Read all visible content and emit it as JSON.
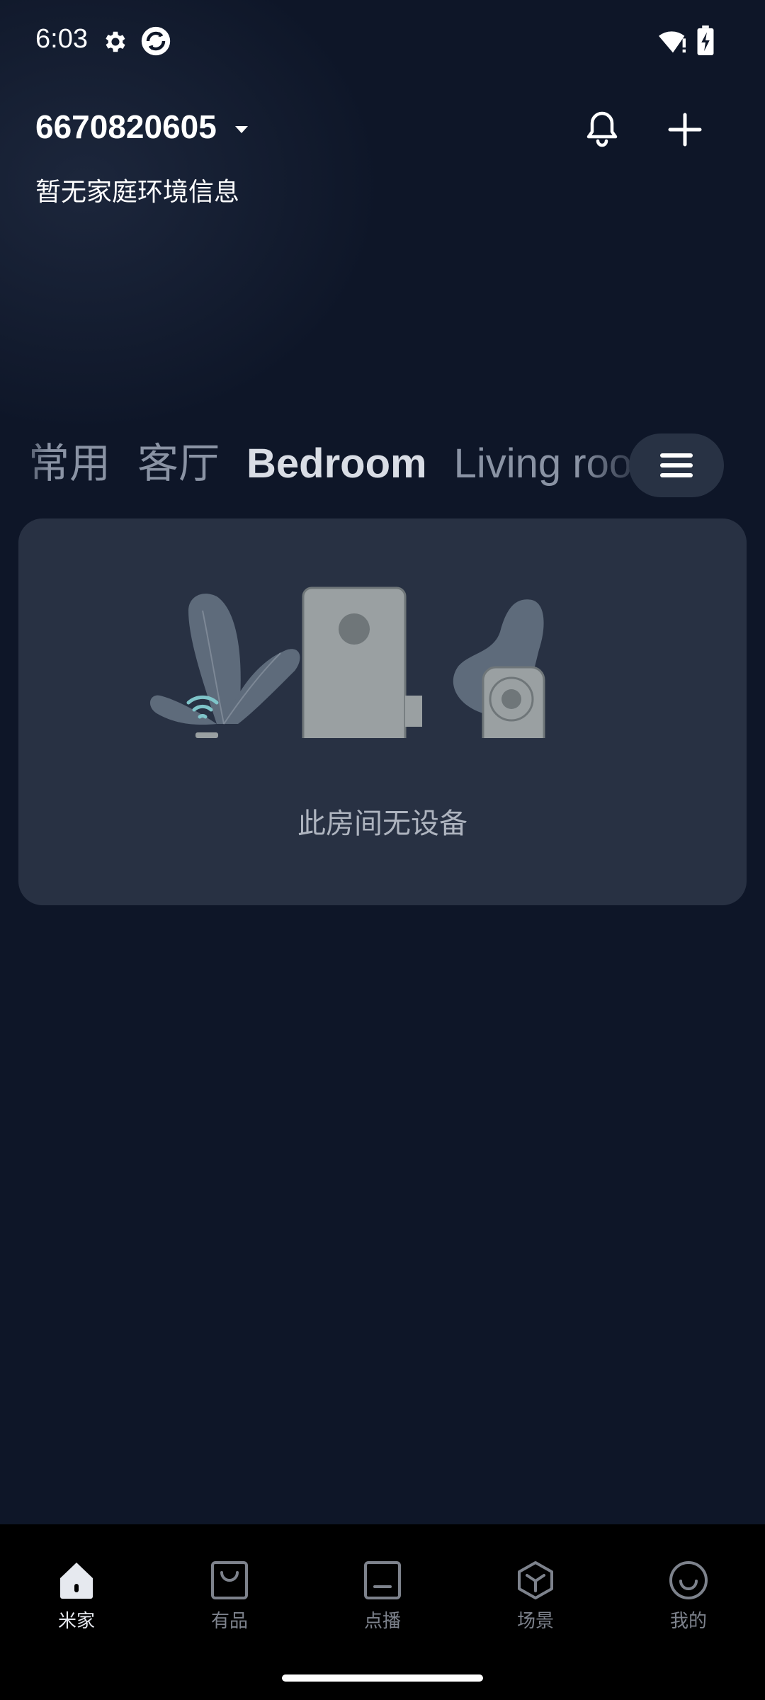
{
  "status_bar": {
    "time": "6:03",
    "icons": [
      "gear-icon",
      "app-sync-icon",
      "wifi-alert-icon",
      "battery-charging-icon"
    ]
  },
  "header": {
    "home_name": "6670820605",
    "env_info": "暂无家庭环境信息",
    "icons": [
      "caret-down-icon",
      "bell-icon",
      "plus-icon"
    ]
  },
  "rooms": {
    "tabs": [
      {
        "label": "常用"
      },
      {
        "label": "客厅"
      },
      {
        "label": "Bedroom",
        "active": true
      },
      {
        "label": "Living room"
      }
    ],
    "menu_icon": "menu-icon"
  },
  "room_card": {
    "empty_message": "此房间无设备"
  },
  "bottom_nav": {
    "items": [
      {
        "label": "米家",
        "icon": "home-icon",
        "active": true
      },
      {
        "label": "有品",
        "icon": "shopping-bag-icon"
      },
      {
        "label": "点播",
        "icon": "tv-icon"
      },
      {
        "label": "场景",
        "icon": "cube-icon"
      },
      {
        "label": "我的",
        "icon": "smile-icon"
      }
    ]
  },
  "colors": {
    "background": "#0e1628",
    "card": "#283143",
    "nav_background": "#000000",
    "accent_wifi": "#7fc4c9"
  }
}
